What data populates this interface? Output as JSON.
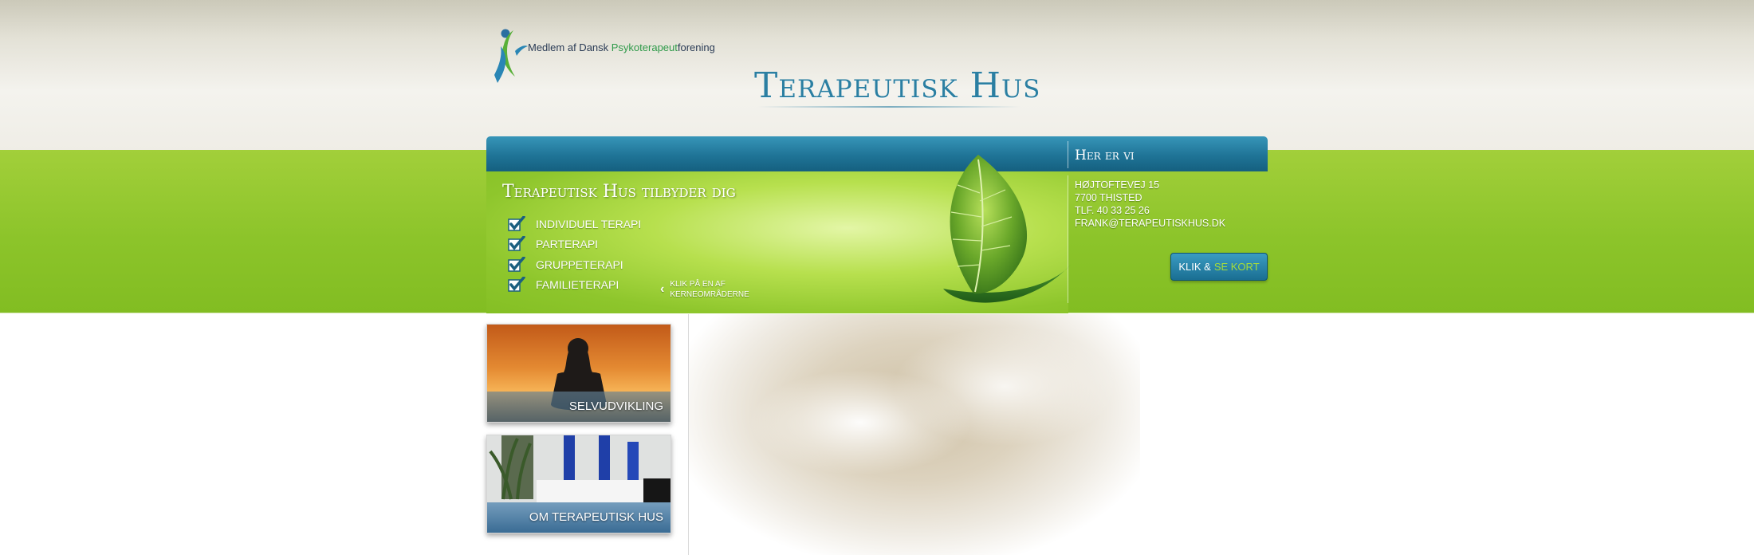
{
  "header": {
    "member_text_prefix": "Medlem af Dansk ",
    "member_text_highlight": "Psykoterapeut",
    "member_text_suffix": "forening",
    "site_title": "Terapeutisk Hus"
  },
  "banner": {
    "offer_title": "Terapeutisk Hus tilbyder dig",
    "services": [
      "INDIVIDUEL TERAPI",
      "PARTERAPI",
      "GRUPPETERAPI",
      "FAMILIETERAPI"
    ],
    "click_hint_line1": "KLIK PÅ EN AF",
    "click_hint_line2": "KERNEOMRÅDERNE"
  },
  "contact": {
    "title": "Her er vi",
    "address": "HØJTOFTEVEJ 15",
    "city": "7700 THISTED",
    "phone": "TLF. 40 33 25 26",
    "email": "FRANK@TERAPEUTISKHUS.DK",
    "map_button_prefix": "KLIK &",
    "map_button_accent": "SE KORT"
  },
  "cards": [
    {
      "label": "SELVUDVIKLING"
    },
    {
      "label": "OM TERAPEUTISK HUS"
    }
  ],
  "colors": {
    "navbar": "#1f7497",
    "green": "#8cc42a",
    "title": "#2b7fa2",
    "accent": "#a6dc3a"
  },
  "icons": [
    "logo-figure-icon",
    "checkmark-icon",
    "chevron-left-icon",
    "leaf-icon"
  ]
}
